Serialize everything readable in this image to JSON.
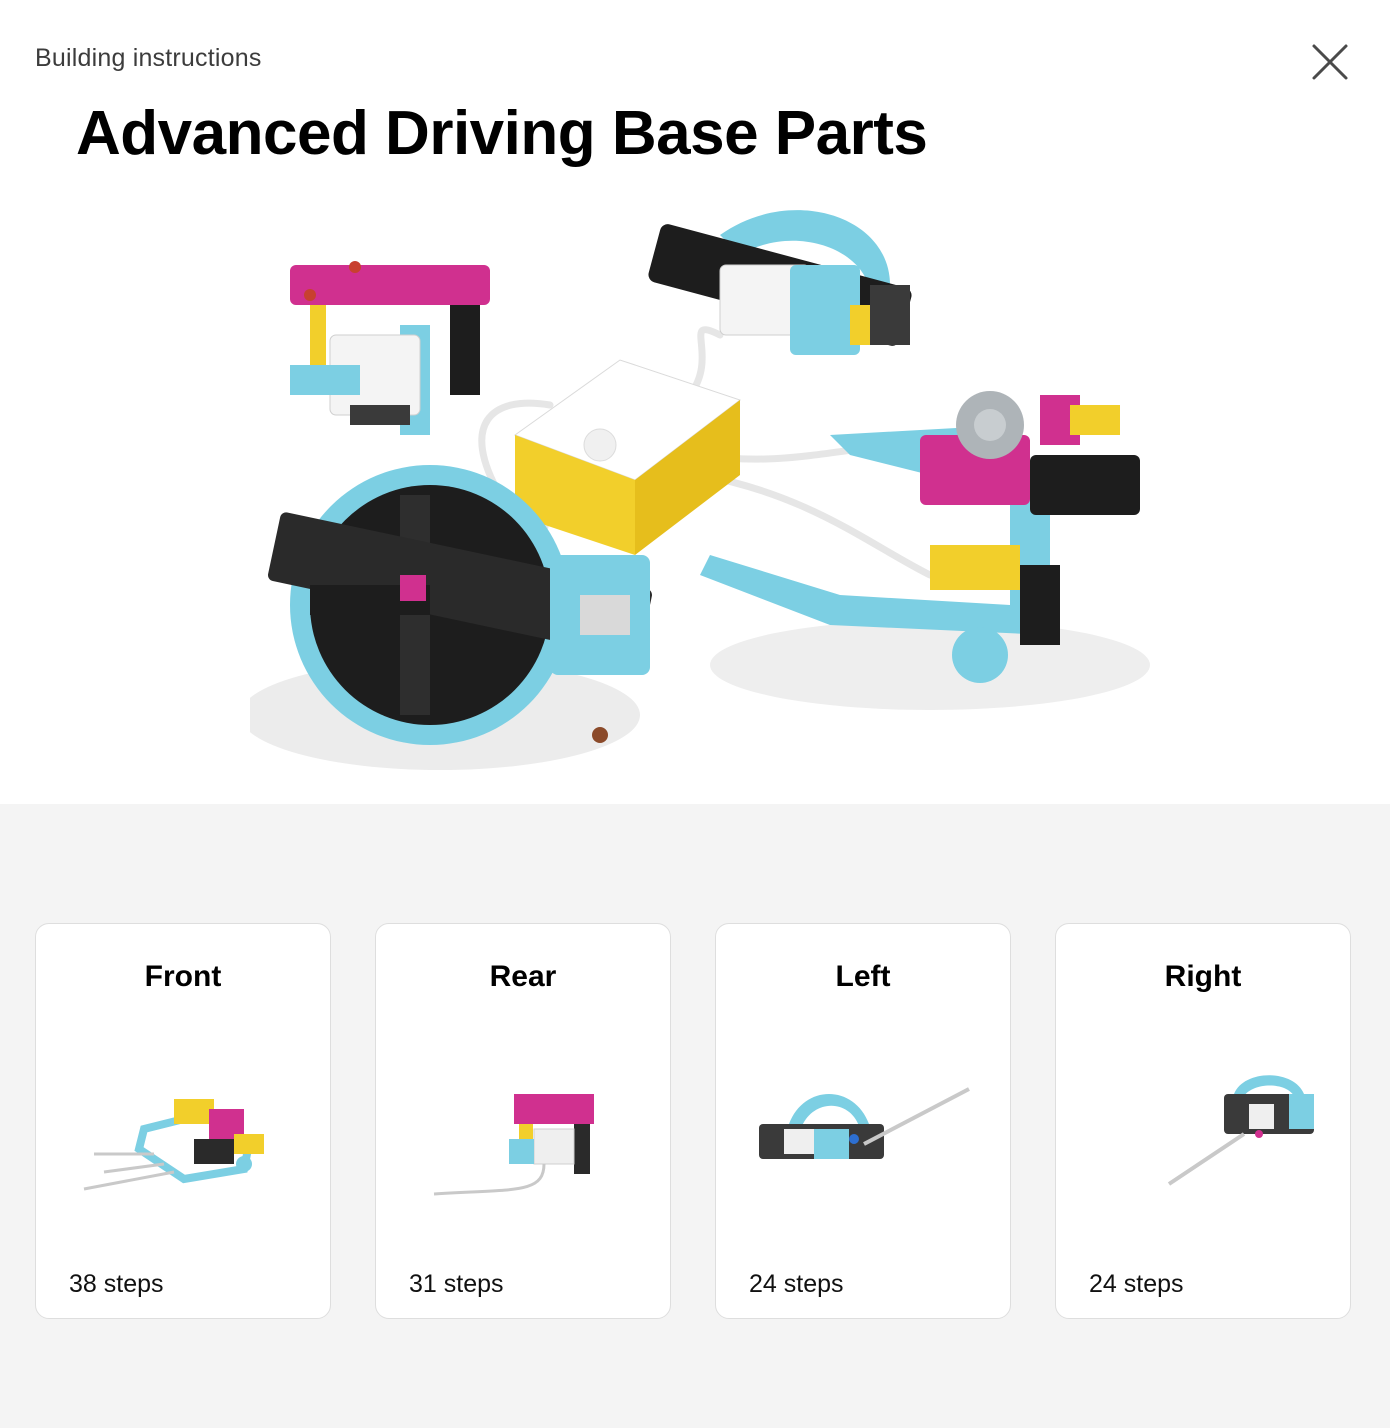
{
  "header": {
    "breadcrumb": "Building instructions",
    "close_icon": "close-icon",
    "title": "Advanced Driving Base Parts"
  },
  "hero": {
    "image": "robot-parts-image"
  },
  "models": [
    {
      "title": "Front",
      "steps": "38 steps",
      "thumb": "front-model-thumbnail"
    },
    {
      "title": "Rear",
      "steps": "31 steps",
      "thumb": "rear-model-thumbnail"
    },
    {
      "title": "Left",
      "steps": "24 steps",
      "thumb": "left-model-thumbnail"
    },
    {
      "title": "Right",
      "steps": "24 steps",
      "thumb": "right-model-thumbnail"
    }
  ],
  "colors": {
    "page_bg": "#ffffff",
    "section_bg": "#f4f4f4",
    "azure": "#7ccfe3",
    "magenta": "#d0308f",
    "yellow": "#f2cf2b",
    "black": "#1d1d1d",
    "gray": "#9da3a8"
  }
}
